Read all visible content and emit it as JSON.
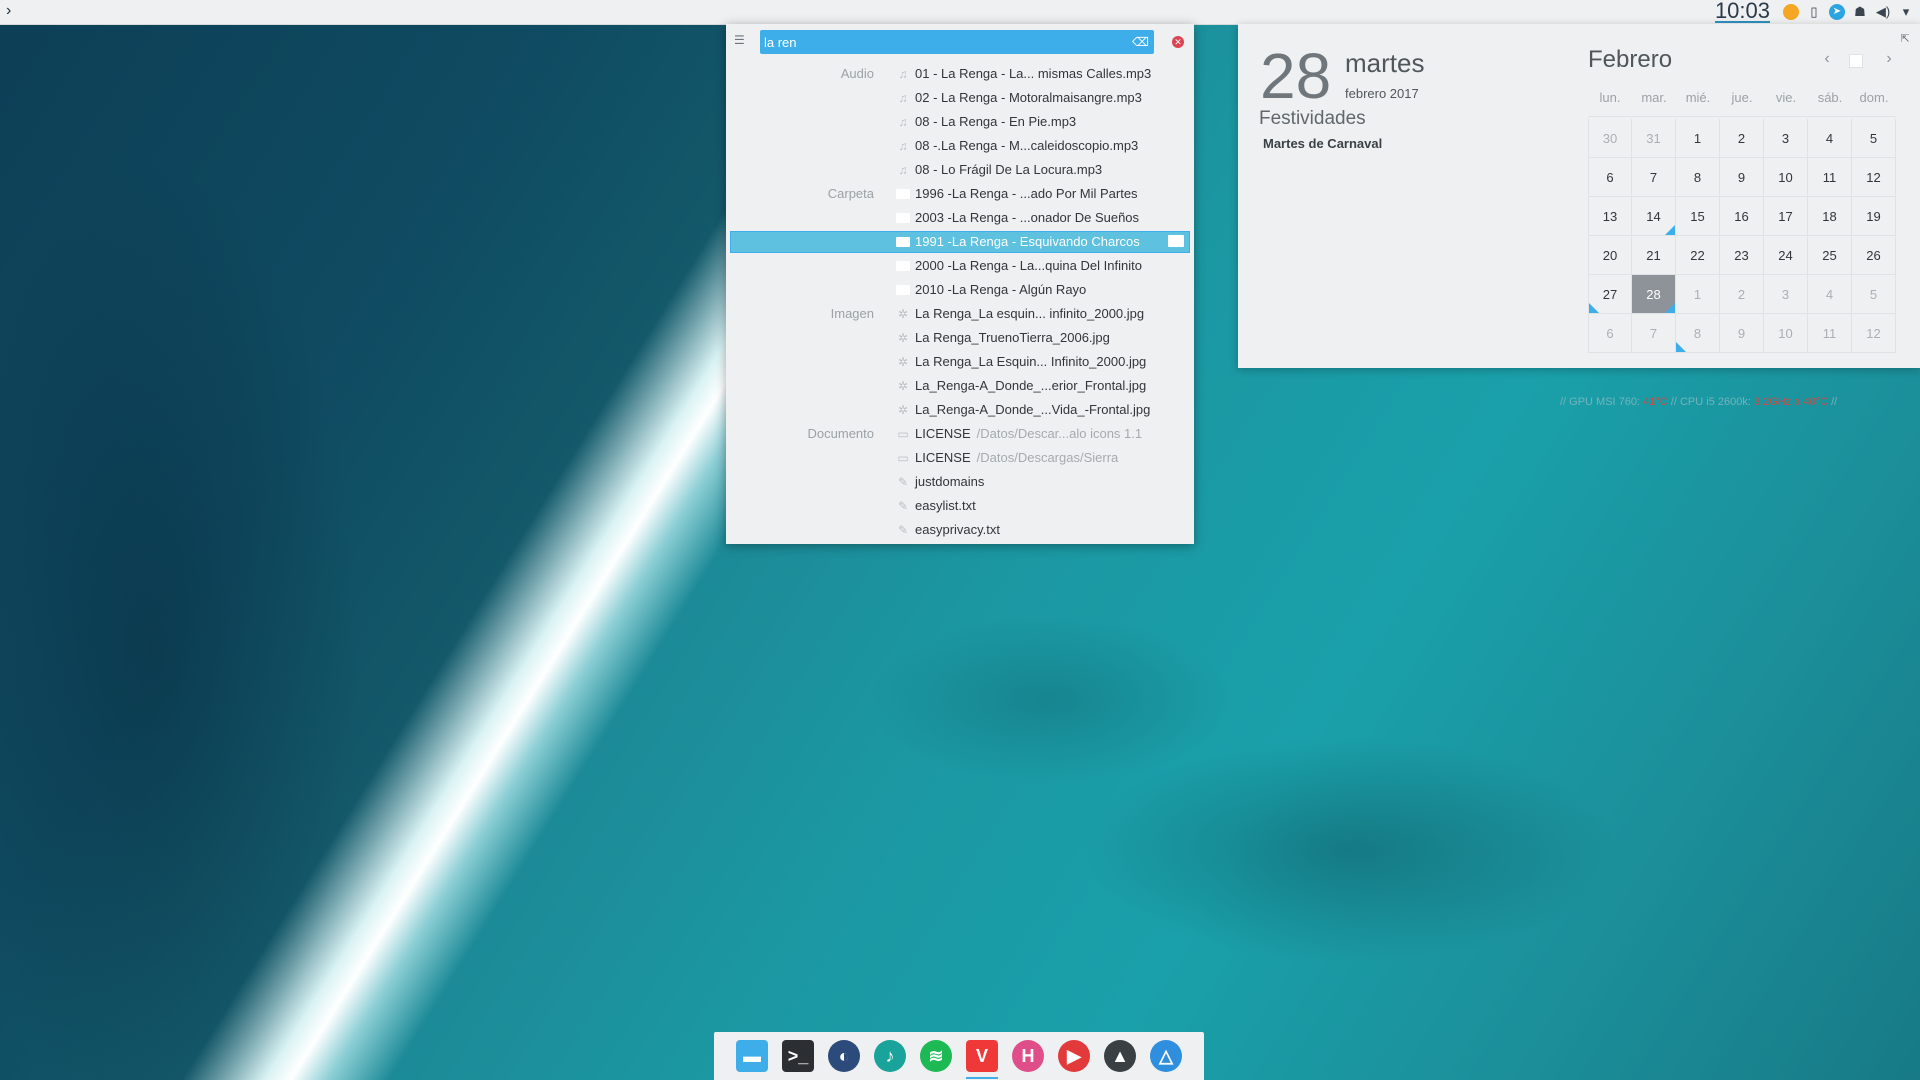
{
  "top_panel": {
    "clock": "10:03",
    "launcher_icon": "chevron-right-icon",
    "tray": [
      {
        "name": "status-dot-icon",
        "color": "#f5a623"
      },
      {
        "name": "battery-icon"
      },
      {
        "name": "telegram-icon",
        "color": "#2ca5e0"
      },
      {
        "name": "ghost-icon"
      },
      {
        "name": "volume-icon"
      },
      {
        "name": "chevron-down-icon"
      }
    ]
  },
  "krunner": {
    "query": "la ren",
    "results": [
      {
        "category": "Audio",
        "icon": "music-note-icon",
        "text": "01 - La Renga - La... mismas Calles.mp3"
      },
      {
        "category": "",
        "icon": "music-note-icon",
        "text": "02 - La Renga - Motoralmaisangre.mp3"
      },
      {
        "category": "",
        "icon": "music-note-icon",
        "text": "08 - La Renga - En Pie.mp3"
      },
      {
        "category": "",
        "icon": "music-note-icon",
        "text": "08 -.La Renga - M...caleidoscopio.mp3"
      },
      {
        "category": "",
        "icon": "music-note-icon",
        "text": "08 - Lo Frágil De La Locura.mp3"
      },
      {
        "category": "Carpeta",
        "icon": "folder-icon",
        "text": "1996 -La Renga -  ...ado Por Mil Partes"
      },
      {
        "category": "",
        "icon": "folder-icon",
        "text": "2003 -La Renga - ...onador De Sueños"
      },
      {
        "category": "",
        "icon": "folder-icon",
        "text": "1991 -La Renga - Esquivando Charcos",
        "selected": true
      },
      {
        "category": "",
        "icon": "folder-icon",
        "text": "2000 -La Renga - La...quina Del Infinito"
      },
      {
        "category": "",
        "icon": "folder-icon",
        "text": "2010 -La Renga - Algún Rayo"
      },
      {
        "category": "Imagen",
        "icon": "image-icon",
        "text": "La Renga_La esquin... infinito_2000.jpg"
      },
      {
        "category": "",
        "icon": "image-icon",
        "text": "La Renga_TruenoTierra_2006.jpg"
      },
      {
        "category": "",
        "icon": "image-icon",
        "text": "La Renga_La Esquin... Infinito_2000.jpg"
      },
      {
        "category": "",
        "icon": "image-icon",
        "text": "La_Renga-A_Donde_...erior_Frontal.jpg"
      },
      {
        "category": "",
        "icon": "image-icon",
        "text": "La_Renga-A_Donde_...Vida_-Frontal.jpg"
      },
      {
        "category": "Documento",
        "icon": "document-icon",
        "text": "LICENSE",
        "sub": "/Datos/Descar...alo icons 1.1"
      },
      {
        "category": "",
        "icon": "document-icon",
        "text": "LICENSE",
        "sub": "/Datos/Descargas/Sierra"
      },
      {
        "category": "",
        "icon": "text-file-icon",
        "text": "justdomains"
      },
      {
        "category": "",
        "icon": "text-file-icon",
        "text": "easylist.txt"
      },
      {
        "category": "",
        "icon": "text-file-icon",
        "text": "easyprivacy.txt"
      }
    ]
  },
  "calendar": {
    "day_number": "28",
    "weekday": "martes",
    "month_year": "febrero 2017",
    "holidays_title": "Festividades",
    "holiday": "Martes de Carnaval",
    "month_title": "Febrero",
    "weekdays": [
      "lun.",
      "mar.",
      "mié.",
      "jue.",
      "vie.",
      "sáb.",
      "dom."
    ],
    "weeks": [
      [
        {
          "d": "30",
          "o": true
        },
        {
          "d": "31",
          "o": true
        },
        {
          "d": "1"
        },
        {
          "d": "2"
        },
        {
          "d": "3"
        },
        {
          "d": "4"
        },
        {
          "d": "5"
        }
      ],
      [
        {
          "d": "6"
        },
        {
          "d": "7"
        },
        {
          "d": "8"
        },
        {
          "d": "9"
        },
        {
          "d": "10"
        },
        {
          "d": "11"
        },
        {
          "d": "12"
        }
      ],
      [
        {
          "d": "13"
        },
        {
          "d": "14",
          "e": true
        },
        {
          "d": "15"
        },
        {
          "d": "16"
        },
        {
          "d": "17"
        },
        {
          "d": "18"
        },
        {
          "d": "19"
        }
      ],
      [
        {
          "d": "20"
        },
        {
          "d": "21"
        },
        {
          "d": "22"
        },
        {
          "d": "23"
        },
        {
          "d": "24"
        },
        {
          "d": "25"
        },
        {
          "d": "26"
        }
      ],
      [
        {
          "d": "27",
          "el": true
        },
        {
          "d": "28",
          "t": true,
          "e": true
        },
        {
          "d": "1",
          "o": true
        },
        {
          "d": "2",
          "o": true
        },
        {
          "d": "3",
          "o": true
        },
        {
          "d": "4",
          "o": true
        },
        {
          "d": "5",
          "o": true
        }
      ],
      [
        {
          "d": "6",
          "o": true
        },
        {
          "d": "7",
          "o": true
        },
        {
          "d": "8",
          "o": true,
          "el": true
        },
        {
          "d": "9",
          "o": true
        },
        {
          "d": "10",
          "o": true
        },
        {
          "d": "11",
          "o": true
        },
        {
          "d": "12",
          "o": true
        }
      ]
    ]
  },
  "conky": {
    "gpu": "// GPU MSI 760:",
    "gpu_value": "41°C",
    "cpu": "// CPU i5 2600k:",
    "cpu_value": "3,2GHz a 40°C",
    "end": "//"
  },
  "dock": [
    {
      "name": "file-manager-icon",
      "color": "#3daee9",
      "glyph": "▬"
    },
    {
      "name": "terminal-icon",
      "color": "#2b2f33",
      "glyph": ">_"
    },
    {
      "name": "browser-icon",
      "color": "#2c4a7a",
      "glyph": "◐"
    },
    {
      "name": "music-player-icon",
      "color": "#1aa39a",
      "glyph": "♪"
    },
    {
      "name": "spotify-icon",
      "color": "#1db954",
      "glyph": "≋"
    },
    {
      "name": "vivaldi-icon",
      "color": "#ef3939",
      "glyph": "V",
      "active": true
    },
    {
      "name": "hexchat-icon",
      "color": "#e04e8a",
      "glyph": "H"
    },
    {
      "name": "media-player-icon",
      "color": "#e23a3a",
      "glyph": "▶"
    },
    {
      "name": "inkscape-icon",
      "color": "#3a3f44",
      "glyph": "▲"
    },
    {
      "name": "app-store-icon",
      "color": "#2f8fde",
      "glyph": "△"
    }
  ]
}
